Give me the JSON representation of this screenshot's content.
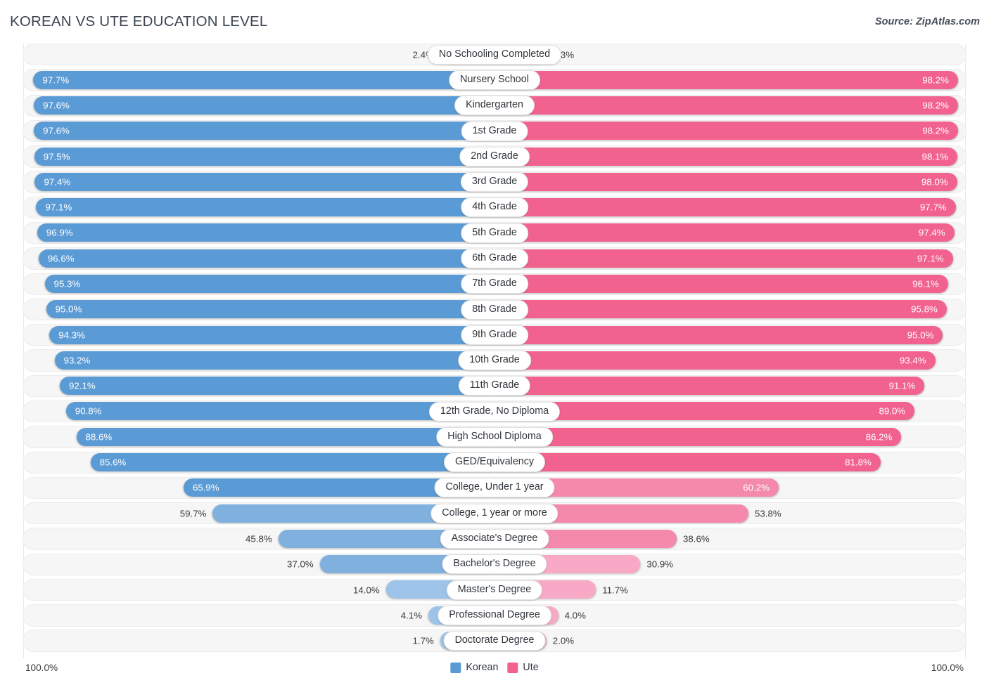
{
  "header": {
    "title": "KOREAN VS UTE EDUCATION LEVEL",
    "source": "Source: ZipAtlas.com"
  },
  "legend": {
    "items": [
      {
        "label": "Korean",
        "color": "#5b9bd5"
      },
      {
        "label": "Ute",
        "color": "#f2628f"
      }
    ]
  },
  "axis": {
    "left_max": "100.0%",
    "right_max": "100.0%"
  },
  "colors": {
    "korean_dark": "#5b9bd5",
    "korean_mid": "#7fb0de",
    "korean_light": "#9dc3e8",
    "ute_dark": "#f2628f",
    "ute_mid": "#f589ac",
    "ute_light": "#f8a9c5",
    "track": "#f6f6f6",
    "track_border": "#ececec",
    "text": "#3a3a3a"
  },
  "chart_data": {
    "type": "bar",
    "orientation": "horizontal-diverging",
    "title": "KOREAN VS UTE EDUCATION LEVEL",
    "xlabel": "",
    "ylabel": "",
    "xlim": [
      0,
      100
    ],
    "unit": "%",
    "grid": false,
    "legend_position": "bottom-center",
    "categories": [
      "No Schooling Completed",
      "Nursery School",
      "Kindergarten",
      "1st Grade",
      "2nd Grade",
      "3rd Grade",
      "4th Grade",
      "5th Grade",
      "6th Grade",
      "7th Grade",
      "8th Grade",
      "9th Grade",
      "10th Grade",
      "11th Grade",
      "12th Grade, No Diploma",
      "High School Diploma",
      "GED/Equivalency",
      "College, Under 1 year",
      "College, 1 year or more",
      "Associate's Degree",
      "Bachelor's Degree",
      "Master's Degree",
      "Professional Degree",
      "Doctorate Degree"
    ],
    "series": [
      {
        "name": "Korean",
        "color": "#5b9bd5",
        "values": [
          2.4,
          97.7,
          97.6,
          97.6,
          97.5,
          97.4,
          97.1,
          96.9,
          96.6,
          95.3,
          95.0,
          94.3,
          93.2,
          92.1,
          90.8,
          88.6,
          85.6,
          65.9,
          59.7,
          45.8,
          37.0,
          14.0,
          4.1,
          1.7
        ]
      },
      {
        "name": "Ute",
        "color": "#f2628f",
        "values": [
          2.3,
          98.2,
          98.2,
          98.2,
          98.1,
          98.0,
          97.7,
          97.4,
          97.1,
          96.1,
          95.8,
          95.0,
          93.4,
          91.1,
          89.0,
          86.2,
          81.8,
          60.2,
          53.8,
          38.6,
          30.9,
          11.7,
          4.0,
          2.0
        ]
      }
    ]
  },
  "rows": [
    {
      "label": "No Schooling Completed",
      "left": "2.4%",
      "right": "2.3%",
      "lw": 11.5,
      "rw": 11.0,
      "lshade": "light",
      "rshade": "light",
      "lin": false,
      "rin": false
    },
    {
      "label": "Nursery School",
      "left": "97.7%",
      "right": "98.2%",
      "lw": 97.7,
      "rw": 98.2,
      "lshade": "dark",
      "rshade": "dark",
      "lin": true,
      "rin": true
    },
    {
      "label": "Kindergarten",
      "left": "97.6%",
      "right": "98.2%",
      "lw": 97.6,
      "rw": 98.2,
      "lshade": "dark",
      "rshade": "dark",
      "lin": true,
      "rin": true
    },
    {
      "label": "1st Grade",
      "left": "97.6%",
      "right": "98.2%",
      "lw": 97.6,
      "rw": 98.2,
      "lshade": "dark",
      "rshade": "dark",
      "lin": true,
      "rin": true
    },
    {
      "label": "2nd Grade",
      "left": "97.5%",
      "right": "98.1%",
      "lw": 97.5,
      "rw": 98.1,
      "lshade": "dark",
      "rshade": "dark",
      "lin": true,
      "rin": true
    },
    {
      "label": "3rd Grade",
      "left": "97.4%",
      "right": "98.0%",
      "lw": 97.4,
      "rw": 98.0,
      "lshade": "dark",
      "rshade": "dark",
      "lin": true,
      "rin": true
    },
    {
      "label": "4th Grade",
      "left": "97.1%",
      "right": "97.7%",
      "lw": 97.1,
      "rw": 97.7,
      "lshade": "dark",
      "rshade": "dark",
      "lin": true,
      "rin": true
    },
    {
      "label": "5th Grade",
      "left": "96.9%",
      "right": "97.4%",
      "lw": 96.9,
      "rw": 97.4,
      "lshade": "dark",
      "rshade": "dark",
      "lin": true,
      "rin": true
    },
    {
      "label": "6th Grade",
      "left": "96.6%",
      "right": "97.1%",
      "lw": 96.6,
      "rw": 97.1,
      "lshade": "dark",
      "rshade": "dark",
      "lin": true,
      "rin": true
    },
    {
      "label": "7th Grade",
      "left": "95.3%",
      "right": "96.1%",
      "lw": 95.3,
      "rw": 96.1,
      "lshade": "dark",
      "rshade": "dark",
      "lin": true,
      "rin": true
    },
    {
      "label": "8th Grade",
      "left": "95.0%",
      "right": "95.8%",
      "lw": 95.0,
      "rw": 95.8,
      "lshade": "dark",
      "rshade": "dark",
      "lin": true,
      "rin": true
    },
    {
      "label": "9th Grade",
      "left": "94.3%",
      "right": "95.0%",
      "lw": 94.3,
      "rw": 95.0,
      "lshade": "dark",
      "rshade": "dark",
      "lin": true,
      "rin": true
    },
    {
      "label": "10th Grade",
      "left": "93.2%",
      "right": "93.4%",
      "lw": 93.2,
      "rw": 93.4,
      "lshade": "dark",
      "rshade": "dark",
      "lin": true,
      "rin": true
    },
    {
      "label": "11th Grade",
      "left": "92.1%",
      "right": "91.1%",
      "lw": 92.1,
      "rw": 91.1,
      "lshade": "dark",
      "rshade": "dark",
      "lin": true,
      "rin": true
    },
    {
      "label": "12th Grade, No Diploma",
      "left": "90.8%",
      "right": "89.0%",
      "lw": 90.8,
      "rw": 89.0,
      "lshade": "dark",
      "rshade": "dark",
      "lin": true,
      "rin": true
    },
    {
      "label": "High School Diploma",
      "left": "88.6%",
      "right": "86.2%",
      "lw": 88.6,
      "rw": 86.2,
      "lshade": "dark",
      "rshade": "dark",
      "lin": true,
      "rin": true
    },
    {
      "label": "GED/Equivalency",
      "left": "85.6%",
      "right": "81.8%",
      "lw": 85.6,
      "rw": 81.8,
      "lshade": "dark",
      "rshade": "dark",
      "lin": true,
      "rin": true
    },
    {
      "label": "College, Under 1 year",
      "left": "65.9%",
      "right": "60.2%",
      "lw": 65.9,
      "rw": 60.2,
      "lshade": "dark",
      "rshade": "mid",
      "lin": true,
      "rin": true
    },
    {
      "label": "College, 1 year or more",
      "left": "59.7%",
      "right": "53.8%",
      "lw": 59.7,
      "rw": 53.8,
      "lshade": "mid",
      "rshade": "mid",
      "lin": false,
      "rin": false
    },
    {
      "label": "Associate's Degree",
      "left": "45.8%",
      "right": "38.6%",
      "lw": 45.8,
      "rw": 38.6,
      "lshade": "mid",
      "rshade": "mid",
      "lin": false,
      "rin": false
    },
    {
      "label": "Bachelor's Degree",
      "left": "37.0%",
      "right": "30.9%",
      "lw": 37.0,
      "rw": 30.9,
      "lshade": "mid",
      "rshade": "light",
      "lin": false,
      "rin": false
    },
    {
      "label": "Master's Degree",
      "left": "14.0%",
      "right": "11.7%",
      "lw": 23.0,
      "rw": 21.5,
      "lshade": "light",
      "rshade": "light",
      "lin": false,
      "rin": false
    },
    {
      "label": "Professional Degree",
      "left": "4.1%",
      "right": "4.0%",
      "lw": 14.0,
      "rw": 13.5,
      "lshade": "light",
      "rshade": "light",
      "lin": false,
      "rin": false
    },
    {
      "label": "Doctorate Degree",
      "left": "1.7%",
      "right": "2.0%",
      "lw": 11.5,
      "rw": 11.0,
      "lshade": "light",
      "rshade": "light",
      "lin": false,
      "rin": false
    }
  ]
}
